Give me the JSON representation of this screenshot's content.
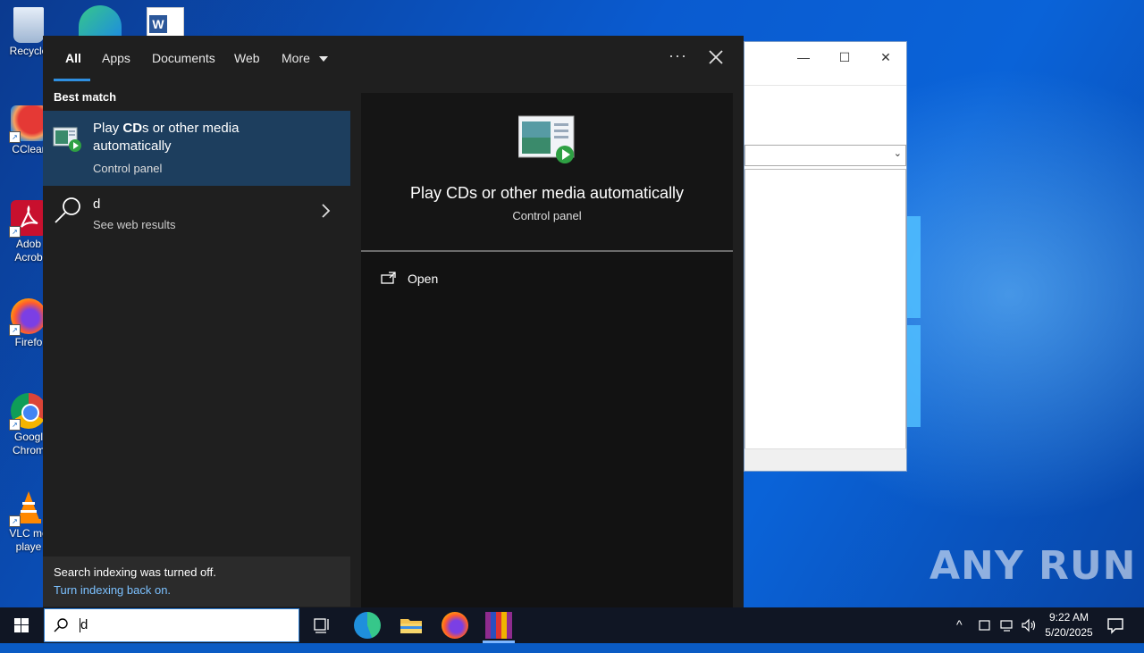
{
  "desktop": {
    "icons": [
      {
        "label": "Recycle Bin",
        "shown": "Recycle"
      },
      {
        "label": "CCleaner",
        "shown": "CClear"
      },
      {
        "label": "Adobe Acrobat",
        "shown": "Adob\nAcrob"
      },
      {
        "label": "Firefox",
        "shown": "Firefo"
      },
      {
        "label": "Google Chrome",
        "shown": "Googl\nChrom"
      },
      {
        "label": "VLC media player",
        "shown": "VLC me\nplaye"
      }
    ]
  },
  "search_panel": {
    "tabs": [
      {
        "label": "All",
        "active": true
      },
      {
        "label": "Apps"
      },
      {
        "label": "Documents"
      },
      {
        "label": "Web"
      },
      {
        "label": "More"
      }
    ],
    "more_options_label": "···",
    "best_match_header": "Best match",
    "best_match": {
      "title_prefix": "Play ",
      "title_bold": "CD",
      "title_suffix": "s or other media automatically",
      "subtitle": "Control panel"
    },
    "web_result": {
      "query": "d",
      "subtitle": "See web results"
    },
    "indexing": {
      "message": "Search indexing was turned off.",
      "link": "Turn indexing back on."
    },
    "preview": {
      "title": "Play CDs or other media automatically",
      "subtitle": "Control panel",
      "actions": [
        {
          "label": "Open"
        }
      ]
    }
  },
  "taskbar": {
    "search_value": "d",
    "clock_time": "9:22 AM",
    "clock_date": "5/20/2025"
  },
  "watermark": "ANY RUN",
  "colors": {
    "accent": "#2f8fe0",
    "selected_row": "#1d3e5e",
    "panel_bg": "#1f1f1f",
    "link": "#7cc1ff"
  }
}
